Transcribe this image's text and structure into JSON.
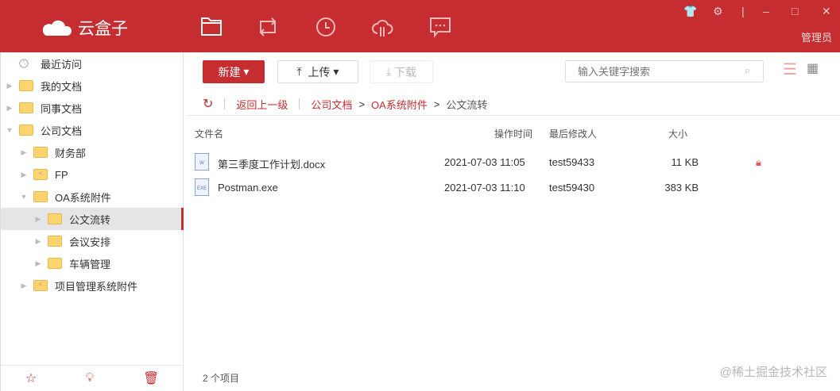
{
  "app": {
    "name": "云盒子",
    "user": "管理员"
  },
  "header": {
    "nav_icons": [
      "folder-icon",
      "sync-icon",
      "clock-icon",
      "cloud-transfer-icon",
      "message-icon"
    ],
    "window_icons": [
      "skin-icon",
      "settings-icon",
      "minimize-icon",
      "maximize-icon",
      "close-icon"
    ]
  },
  "sidebar": {
    "items": [
      {
        "label": "最近访问",
        "level": 0,
        "icon": "clock",
        "arrow": ""
      },
      {
        "label": "我的文档",
        "level": 0,
        "icon": "folder",
        "arrow": "right"
      },
      {
        "label": "同事文档",
        "level": 0,
        "icon": "folder",
        "arrow": "right"
      },
      {
        "label": "公司文档",
        "level": 0,
        "icon": "folder",
        "arrow": "down"
      },
      {
        "label": "财务部",
        "level": 1,
        "icon": "folder",
        "arrow": "right"
      },
      {
        "label": "FP",
        "level": 1,
        "icon": "shared-folder",
        "arrow": "right"
      },
      {
        "label": "OA系统附件",
        "level": 1,
        "icon": "folder",
        "arrow": "down"
      },
      {
        "label": "公文流转",
        "level": 2,
        "icon": "folder",
        "arrow": "right",
        "selected": true
      },
      {
        "label": "会议安排",
        "level": 2,
        "icon": "folder",
        "arrow": "right"
      },
      {
        "label": "车辆管理",
        "level": 2,
        "icon": "folder",
        "arrow": "right"
      },
      {
        "label": "项目管理系统附件",
        "level": 1,
        "icon": "shared-folder",
        "arrow": "right"
      }
    ]
  },
  "toolbar": {
    "new_label": "新建",
    "upload_label": "上传",
    "download_label": "下载",
    "search_placeholder": "输入关键字搜索"
  },
  "breadcrumb": {
    "back": "返回上一级",
    "path": [
      "公司文档",
      "OA系统附件",
      "公文流转"
    ]
  },
  "table": {
    "headers": [
      "文件名",
      "操作时间",
      "最后修改人",
      "大小"
    ],
    "rows": [
      {
        "name": "第三季度工作计划.docx",
        "time": "2021-07-03 11:05",
        "user": "test59433",
        "size": "11 KB",
        "type": "W",
        "locked": true
      },
      {
        "name": "Postman.exe",
        "time": "2021-07-03 11:10",
        "user": "test59430",
        "size": "383 KB",
        "type": "EXE",
        "locked": false
      }
    ]
  },
  "footer": {
    "count": "2 个项目"
  },
  "watermark": "@稀土掘金技术社区",
  "colors": {
    "brand": "#c52d31"
  }
}
